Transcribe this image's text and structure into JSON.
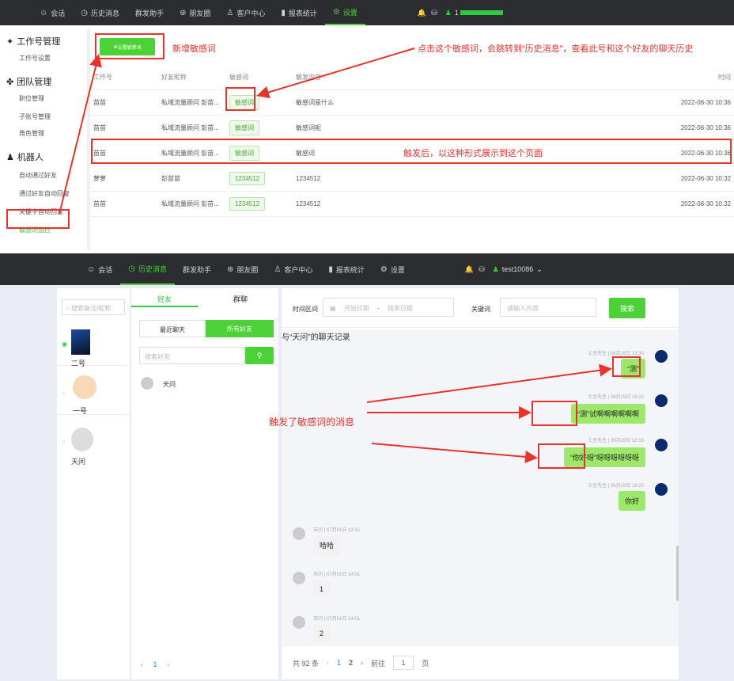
{
  "top1": {
    "nav": [
      {
        "icon": "chat-icon",
        "label": "会话"
      },
      {
        "icon": "clock-icon",
        "label": "历史消息"
      },
      {
        "icon": "",
        "label": "群发助手"
      },
      {
        "icon": "aperture-icon",
        "label": "朋友圈"
      },
      {
        "icon": "user-icon",
        "label": "客户中心"
      },
      {
        "icon": "bar-chart-icon",
        "label": "报表统计"
      },
      {
        "icon": "gear-icon",
        "label": "设置"
      }
    ],
    "user": "1"
  },
  "side1": {
    "groups": [
      {
        "title": "工作号管理",
        "items": [
          "工作号设置"
        ]
      },
      {
        "title": "团队管理",
        "items": [
          "职位管理",
          "子账号管理",
          "角色管理"
        ]
      },
      {
        "title": "机器人",
        "items": [
          "自动通过好友",
          "通过好友自动回复",
          "关键字自动回复",
          "敏感词监控"
        ]
      }
    ]
  },
  "table1": {
    "add_button": "设置敏感词",
    "columns": [
      "工作号",
      "好友昵称",
      "敏感词",
      "触发内容",
      "时间"
    ],
    "rows": [
      {
        "work": "苗苗",
        "friend": "私域流量顾问 彭苗...",
        "word": "敏感词",
        "content": "敏感词是什么",
        "time": "2022-06-30 10:36"
      },
      {
        "work": "苗苗",
        "friend": "私域流量顾问 彭苗...",
        "word": "敏感词",
        "content": "敏感词呢",
        "time": "2022-06-30 10:36"
      },
      {
        "work": "苗苗",
        "friend": "私域流量顾问 彭苗...",
        "word": "敏感词",
        "content": "敏感词",
        "time": "2022-06-30 10:36"
      },
      {
        "work": "萝萝",
        "friend": "彭苗苗",
        "word": "1234512",
        "content": "1234512",
        "time": "2022-06-30 10:32"
      },
      {
        "work": "苗苗",
        "friend": "私域流量顾问 彭苗...",
        "word": "1234512",
        "content": "1234512",
        "time": "2022-06-30 10:32"
      }
    ]
  },
  "annotations": {
    "a1": "新增敏感词",
    "a2": "点击这个敏感词，会跳转到“历史消息”，查看此号和这个好友的聊天历史",
    "a3": "触发后，以这种形式展示到这个页面",
    "a4": "触发了敏感词的消息"
  },
  "top2": {
    "nav": [
      {
        "icon": "chat-icon",
        "label": "会话"
      },
      {
        "icon": "clock-icon",
        "label": "历史消息"
      },
      {
        "icon": "",
        "label": "群发助手"
      },
      {
        "icon": "aperture-icon",
        "label": "朋友圈"
      },
      {
        "icon": "user-icon",
        "label": "客户中心"
      },
      {
        "icon": "bar-chart-icon",
        "label": "报表统计"
      },
      {
        "icon": "gear-icon",
        "label": "设置"
      }
    ],
    "user": "test10086"
  },
  "accounts": {
    "search_placeholder": "搜索备注/昵称",
    "items": [
      "二号",
      "一号",
      "天问"
    ]
  },
  "friends": {
    "tabs": [
      "好友",
      "群聊"
    ],
    "toggle": [
      "最近聊天",
      "所有好友"
    ],
    "search_placeholder": "搜索好友",
    "items": [
      "天问"
    ],
    "pager": {
      "current": "1"
    }
  },
  "history": {
    "time_label": "时间区间",
    "start_placeholder": "开始日期",
    "dash": "-",
    "end_placeholder": "结束日期",
    "keyword_label": "关键词",
    "keyword_placeholder": "请输入内容",
    "search_button": "搜索",
    "title": "与“天问”的聊天记录",
    "messages": [
      {
        "meta": "土豆先生 | 06月28日 13:30",
        "text": "“测”"
      },
      {
        "meta": "土豆先生 | 06月29日 18:32",
        "text": "“测”试啊啊啊啊啊啊"
      },
      {
        "meta": "土豆先生 | 06月29日 18:33",
        "text": "“你好呀”呀呀呀呀呀呀"
      },
      {
        "meta": "土豆先生 | 06月29日 18:33",
        "text": "你好"
      },
      {
        "meta": "天问 | 07月01日 12:32",
        "text": "哈哈"
      },
      {
        "meta": "天问 | 07月01日 14:01",
        "text": "1"
      },
      {
        "meta": "天问 | 07月01日 14:01",
        "text": "2"
      }
    ],
    "pager": {
      "total": "共 92 条",
      "pages": [
        "1",
        "2"
      ],
      "goto": "前往",
      "page_input": "1",
      "page_unit": "页"
    }
  }
}
